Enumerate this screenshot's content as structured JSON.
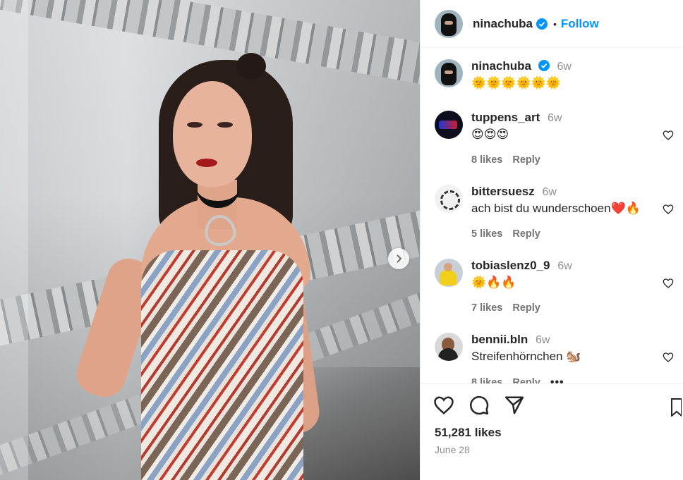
{
  "post": {
    "author": "ninachuba",
    "verified": true,
    "follow_label": "Follow",
    "separator": "•",
    "caption_time": "6w",
    "caption": "🌞🌞🌞🌞🌞🌞"
  },
  "comments": [
    {
      "user": "tuppens_art",
      "time": "6w",
      "text": "😍😍😍",
      "likes": "8 likes",
      "reply": "Reply"
    },
    {
      "user": "bittersuesz",
      "time": "6w",
      "text": "ach bist du wunderschoen❤️🔥",
      "likes": "5 likes",
      "reply": "Reply"
    },
    {
      "user": "tobiaslenz0_9",
      "time": "6w",
      "text": "🌞🔥🔥",
      "likes": "7 likes",
      "reply": "Reply"
    },
    {
      "user": "bennii.bln",
      "time": "6w",
      "text": "Streifenhörnchen 🐿️",
      "likes": "8 likes",
      "reply": "Reply",
      "more": "•••"
    }
  ],
  "footer": {
    "likes": "51,281 likes",
    "date": "June 28"
  },
  "icons": {
    "verified": "verified-badge-icon",
    "like": "heart-icon",
    "comment": "comment-icon",
    "share": "paper-plane-icon",
    "next": "chevron-right-icon"
  },
  "colors": {
    "accent": "#0095f6",
    "muted": "#8e8e8e",
    "text": "#262626"
  }
}
